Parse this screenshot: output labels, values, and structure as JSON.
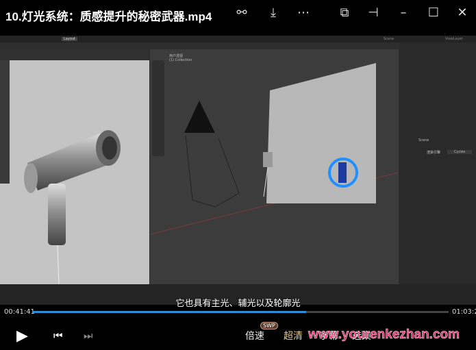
{
  "window": {
    "title": "10.灯光系统：质感提升的秘密武器.mp4",
    "icons": [
      "share-icon",
      "download-icon",
      "more-icon",
      "pip-icon",
      "pin-icon",
      "minimize-icon",
      "maximize-icon",
      "close-icon"
    ]
  },
  "blender": {
    "workspace_tab": "Layout",
    "scene": "Scene",
    "view_layer": "ViewLayer",
    "viewport_label": "用户透视",
    "collection": "(1) Collection",
    "render_engine": "Cycles"
  },
  "video": {
    "subtitle": "它也具有主光、辅光以及轮廓光",
    "current_time": "00:41:41",
    "total_time": "01:03:2",
    "progress": 0.658,
    "accent": "#2a8fd6"
  },
  "controls": {
    "speed": "倍速",
    "quality": "超清",
    "subtitles": "字幕",
    "episodes": "选集",
    "badge": "SWP"
  },
  "watermark": "www.yourenkezhan.com"
}
